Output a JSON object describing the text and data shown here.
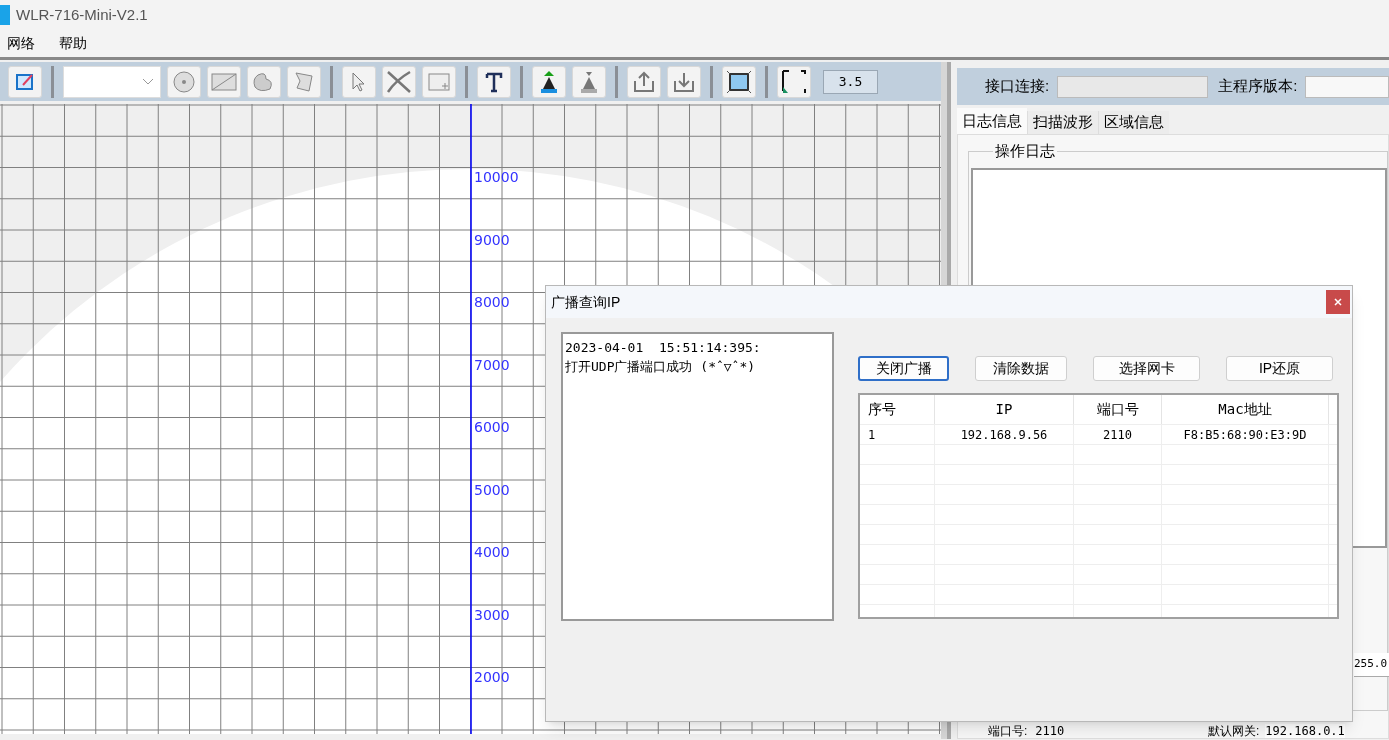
{
  "window": {
    "title": "WLR-716-Mini-V2.1"
  },
  "menu": [
    {
      "label": "网络"
    },
    {
      "label": "帮助"
    }
  ],
  "toolbar": {
    "zoom_value": "3.5"
  },
  "canvas": {
    "axis_labels": [
      "10000",
      "9000",
      "8000",
      "7000",
      "6000",
      "5000",
      "4000",
      "3000",
      "2000"
    ]
  },
  "right_panel": {
    "interface_label": "接口连接:",
    "version_label": "主程序版本:",
    "tabs": [
      {
        "label": "日志信息",
        "selected": true
      },
      {
        "label": "扫描波形",
        "selected": false
      },
      {
        "label": "区域信息",
        "selected": false
      }
    ],
    "log_group": "操作日志",
    "mask_fragment": "255.0",
    "port_label": "端口号:",
    "port_value": "2110",
    "gateway_label": "默认网关:",
    "gateway_value": "192.168.0.1"
  },
  "dialog": {
    "title": "广播查询IP",
    "log_lines": [
      "2023-04-01  15:51:14:395:",
      "打开UDP广播端口成功 (*ˆ▽ˆ*)"
    ],
    "buttons": [
      {
        "label": "关闭广播",
        "focused": true
      },
      {
        "label": "清除数据",
        "focused": false
      },
      {
        "label": "选择网卡",
        "focused": false
      },
      {
        "label": "IP还原",
        "focused": false
      }
    ],
    "table": {
      "columns": [
        "序号",
        "IP",
        "端口号",
        "Mac地址"
      ],
      "rows": [
        [
          "1",
          "192.168.9.56",
          "2110",
          "F8:B5:68:90:E3:9D"
        ]
      ]
    }
  }
}
